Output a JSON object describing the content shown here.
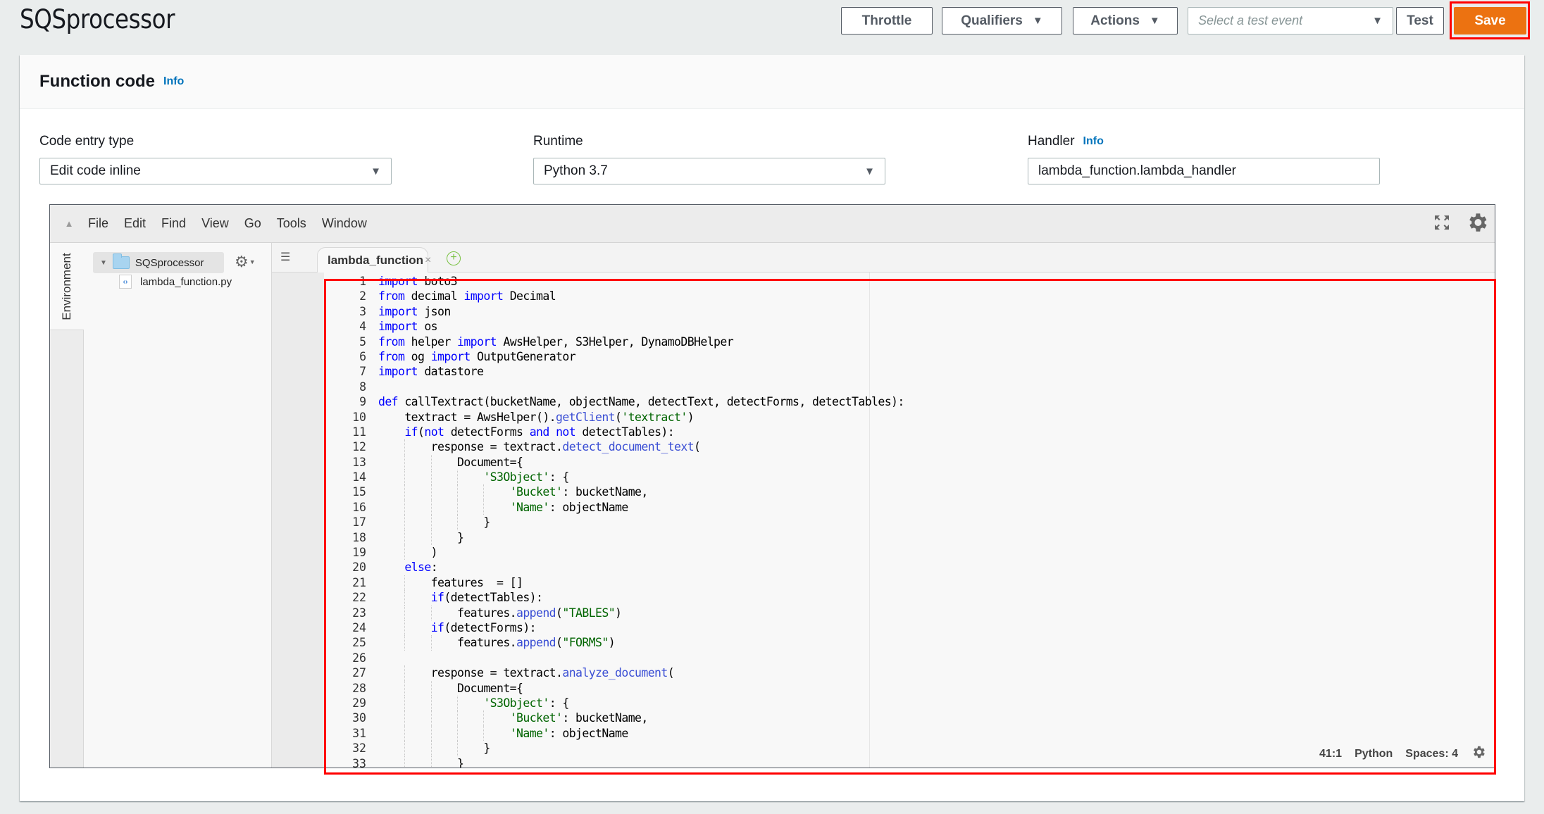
{
  "page": {
    "title": "SQSprocessor"
  },
  "toolbar": {
    "throttle_label": "Throttle",
    "qualifiers_label": "Qualifiers",
    "actions_label": "Actions",
    "test_event_placeholder": "Select a test event",
    "test_label": "Test",
    "save_label": "Save"
  },
  "function_code": {
    "title": "Function code",
    "info_label": "Info",
    "code_entry_type": {
      "label": "Code entry type",
      "value": "Edit code inline"
    },
    "runtime": {
      "label": "Runtime",
      "value": "Python 3.7"
    },
    "handler": {
      "label": "Handler",
      "info_label": "Info",
      "value": "lambda_function.lambda_handler"
    }
  },
  "editor": {
    "menu": [
      "File",
      "Edit",
      "Find",
      "View",
      "Go",
      "Tools",
      "Window"
    ],
    "environment_tab": "Environment",
    "tree": {
      "root": "SQSprocessor",
      "files": [
        "lambda_function.py"
      ]
    },
    "open_tab": "lambda_function",
    "status": {
      "cursor": "41:1",
      "language": "Python",
      "indent": "Spaces: 4"
    },
    "code_lines": [
      [
        [
          "kw",
          "import"
        ],
        [
          "t",
          " boto3"
        ]
      ],
      [
        [
          "kw",
          "from"
        ],
        [
          "t",
          " decimal "
        ],
        [
          "kw",
          "import"
        ],
        [
          "t",
          " Decimal"
        ]
      ],
      [
        [
          "kw",
          "import"
        ],
        [
          "t",
          " json"
        ]
      ],
      [
        [
          "kw",
          "import"
        ],
        [
          "t",
          " os"
        ]
      ],
      [
        [
          "kw",
          "from"
        ],
        [
          "t",
          " helper "
        ],
        [
          "kw",
          "import"
        ],
        [
          "t",
          " AwsHelper, S3Helper, DynamoDBHelper"
        ]
      ],
      [
        [
          "kw",
          "from"
        ],
        [
          "t",
          " og "
        ],
        [
          "kw",
          "import"
        ],
        [
          "t",
          " OutputGenerator"
        ]
      ],
      [
        [
          "kw",
          "import"
        ],
        [
          "t",
          " datastore"
        ]
      ],
      [],
      [
        [
          "kw",
          "def"
        ],
        [
          "t",
          " callTextract(bucketName, objectName, detectText, detectForms, detectTables):"
        ]
      ],
      [
        [
          "t",
          "    textract = AwsHelper()."
        ],
        [
          "fn",
          "getClient"
        ],
        [
          "t",
          "("
        ],
        [
          "str",
          "'textract'"
        ],
        [
          "t",
          ")"
        ]
      ],
      [
        [
          "t",
          "    "
        ],
        [
          "kw",
          "if"
        ],
        [
          "t",
          "("
        ],
        [
          "kw",
          "not"
        ],
        [
          "t",
          " detectForms "
        ],
        [
          "kw",
          "and"
        ],
        [
          "t",
          " "
        ],
        [
          "kw",
          "not"
        ],
        [
          "t",
          " detectTables):"
        ]
      ],
      [
        [
          "t",
          "        response = textract."
        ],
        [
          "fn",
          "detect_document_text"
        ],
        [
          "t",
          "("
        ]
      ],
      [
        [
          "t",
          "            Document={"
        ]
      ],
      [
        [
          "t",
          "                "
        ],
        [
          "str",
          "'S3Object'"
        ],
        [
          "t",
          ": {"
        ]
      ],
      [
        [
          "t",
          "                    "
        ],
        [
          "str",
          "'Bucket'"
        ],
        [
          "t",
          ": bucketName,"
        ]
      ],
      [
        [
          "t",
          "                    "
        ],
        [
          "str",
          "'Name'"
        ],
        [
          "t",
          ": objectName"
        ]
      ],
      [
        [
          "t",
          "                }"
        ]
      ],
      [
        [
          "t",
          "            }"
        ]
      ],
      [
        [
          "t",
          "        )"
        ]
      ],
      [
        [
          "t",
          "    "
        ],
        [
          "kw",
          "else"
        ],
        [
          "t",
          ":"
        ]
      ],
      [
        [
          "t",
          "        features  = []"
        ]
      ],
      [
        [
          "t",
          "        "
        ],
        [
          "kw",
          "if"
        ],
        [
          "t",
          "(detectTables):"
        ]
      ],
      [
        [
          "t",
          "            features."
        ],
        [
          "fn",
          "append"
        ],
        [
          "t",
          "("
        ],
        [
          "str",
          "\"TABLES\""
        ],
        [
          "t",
          ")"
        ]
      ],
      [
        [
          "t",
          "        "
        ],
        [
          "kw",
          "if"
        ],
        [
          "t",
          "(detectForms):"
        ]
      ],
      [
        [
          "t",
          "            features."
        ],
        [
          "fn",
          "append"
        ],
        [
          "t",
          "("
        ],
        [
          "str",
          "\"FORMS\""
        ],
        [
          "t",
          ")"
        ]
      ],
      [],
      [
        [
          "t",
          "        response = textract."
        ],
        [
          "fn",
          "analyze_document"
        ],
        [
          "t",
          "("
        ]
      ],
      [
        [
          "t",
          "            Document={"
        ]
      ],
      [
        [
          "t",
          "                "
        ],
        [
          "str",
          "'S3Object'"
        ],
        [
          "t",
          ": {"
        ]
      ],
      [
        [
          "t",
          "                    "
        ],
        [
          "str",
          "'Bucket'"
        ],
        [
          "t",
          ": bucketName,"
        ]
      ],
      [
        [
          "t",
          "                    "
        ],
        [
          "str",
          "'Name'"
        ],
        [
          "t",
          ": objectName"
        ]
      ],
      [
        [
          "t",
          "                }"
        ]
      ],
      [
        [
          "t",
          "            }"
        ]
      ]
    ]
  },
  "colors": {
    "save": "#ec7211",
    "link": "#0073bb",
    "highlight": "#ff0000"
  }
}
